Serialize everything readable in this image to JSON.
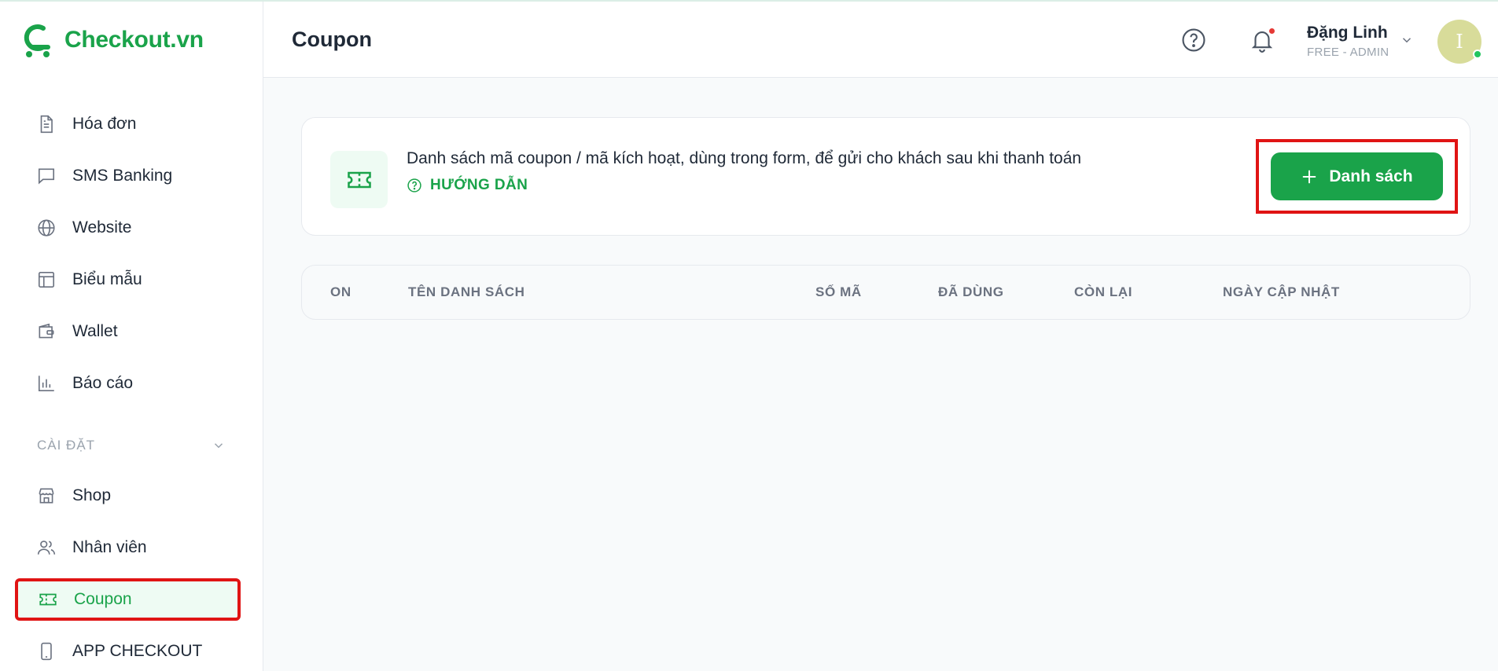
{
  "brand": {
    "name": "Checkout.vn"
  },
  "sidebar": {
    "items": [
      {
        "label": "Hóa đơn",
        "icon": "invoice-icon"
      },
      {
        "label": "SMS Banking",
        "icon": "message-icon"
      },
      {
        "label": "Website",
        "icon": "globe-icon"
      },
      {
        "label": "Biểu mẫu",
        "icon": "layout-icon"
      },
      {
        "label": "Wallet",
        "icon": "wallet-icon"
      },
      {
        "label": "Báo cáo",
        "icon": "bar-chart-icon"
      }
    ],
    "settings_section": "CÀI ĐẶT",
    "settings_items": [
      {
        "label": "Shop",
        "icon": "store-icon"
      },
      {
        "label": "Nhân viên",
        "icon": "users-icon"
      },
      {
        "label": "Coupon",
        "icon": "coupon-icon",
        "active": true
      },
      {
        "label": "APP CHECKOUT",
        "icon": "phone-icon"
      }
    ]
  },
  "header": {
    "title": "Coupon",
    "user_name": "Đặng Linh",
    "user_role": "FREE - ADMIN",
    "avatar_letter": "I"
  },
  "info_card": {
    "description": "Danh sách mã coupon / mã kích hoạt, dùng trong form, để gửi cho khách sau khi thanh toán",
    "guide_label": "HƯỚNG DẪN",
    "button_label": "Danh sách"
  },
  "table": {
    "columns": [
      "ON",
      "TÊN DANH SÁCH",
      "SỐ MÃ",
      "ĐÃ DÙNG",
      "CÒN LẠI",
      "NGÀY CẬP NHẬT"
    ]
  },
  "colors": {
    "brand": "#1aa34a",
    "highlight": "#e01414",
    "active_bg": "#eefbf3"
  }
}
